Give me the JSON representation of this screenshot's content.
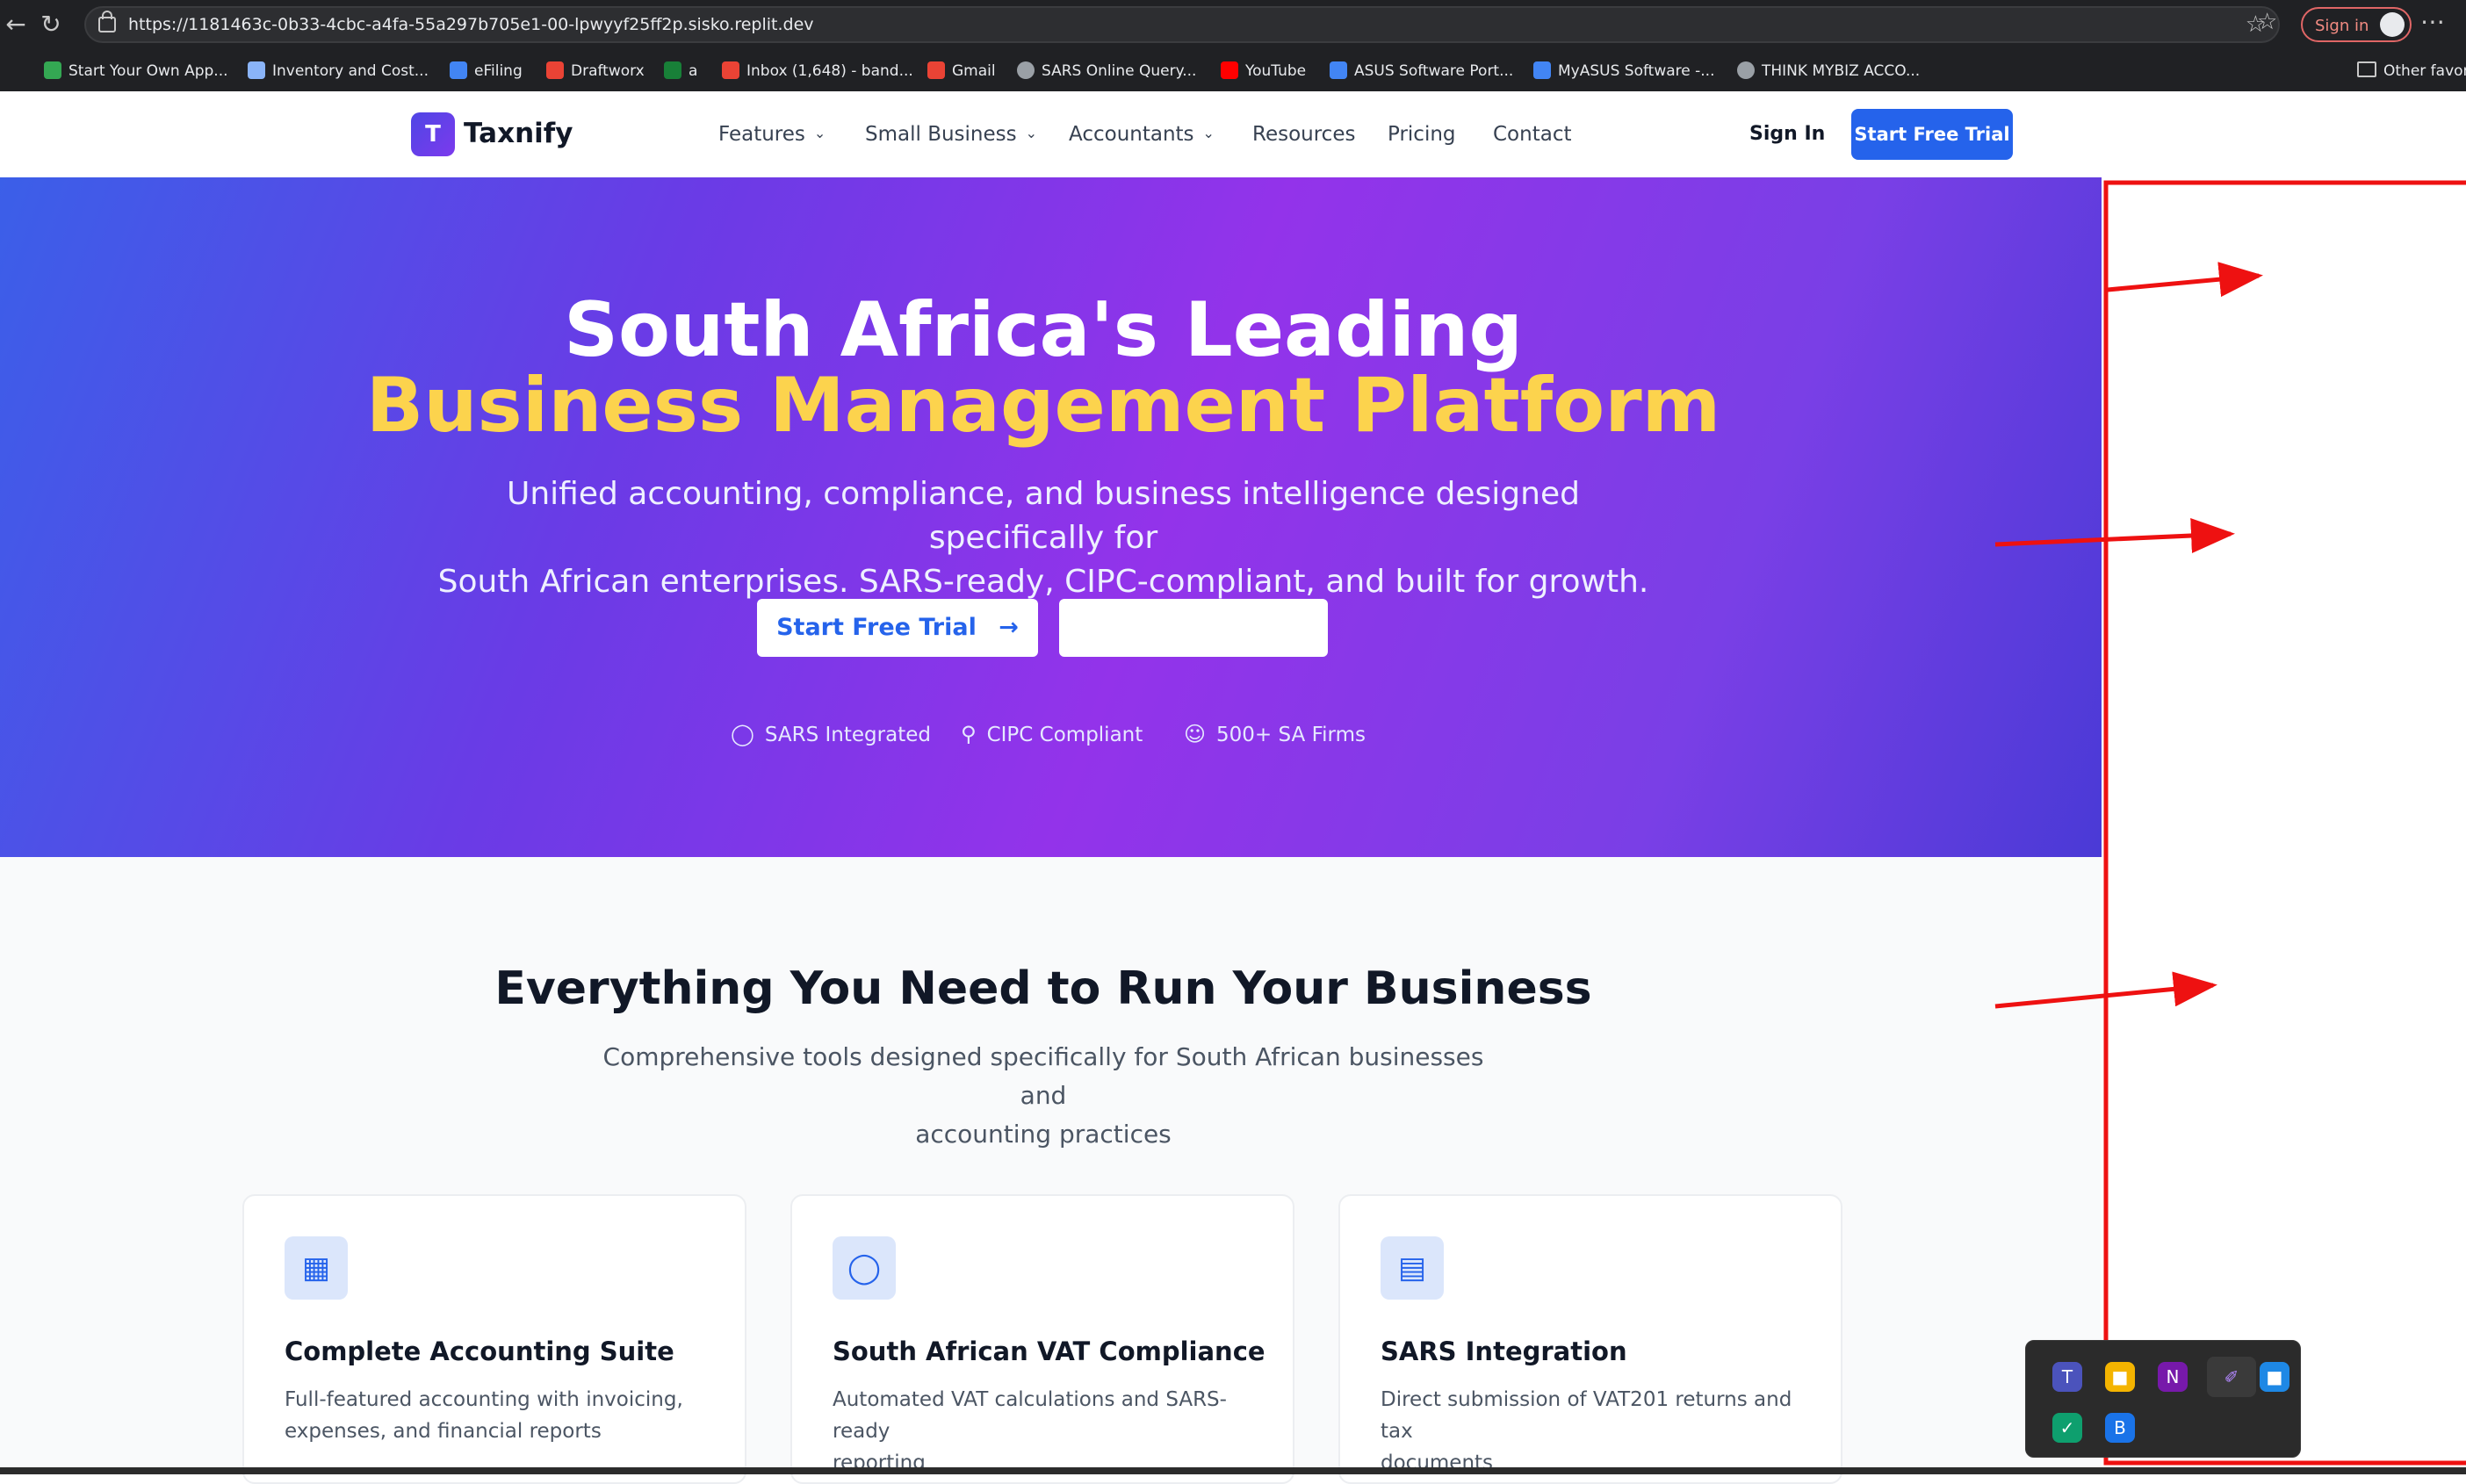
{
  "browser": {
    "url": "https://1181463c-0b33-4cbc-a4fa-55a297b705e1-00-lpwyyf25ff2p.sisko.replit.dev",
    "signin_label": "Sign in",
    "bookmarks": [
      {
        "label": "Start Your Own App...",
        "color": "#34a853"
      },
      {
        "label": "Inventory and Cost...",
        "color": "#8ab4f8"
      },
      {
        "label": "eFiling",
        "color": "#4285f4"
      },
      {
        "label": "Draftworx",
        "color": "#ea4335"
      },
      {
        "label": "a",
        "color": "#188038"
      },
      {
        "label": "Inbox (1,648) - band...",
        "color": "#ea4335"
      },
      {
        "label": "Gmail",
        "color": "#ea4335"
      },
      {
        "label": "SARS Online Query...",
        "color": "#9aa0a6"
      },
      {
        "label": "YouTube",
        "color": "#ff0000"
      },
      {
        "label": "ASUS Software Port...",
        "color": "#4285f4"
      },
      {
        "label": "MyASUS Software -...",
        "color": "#4285f4"
      },
      {
        "label": "THINK MYBIZ ACCO...",
        "color": "#9aa0a6"
      },
      {
        "label": "Other favor",
        "color": "#9aa0a6"
      }
    ]
  },
  "nav": {
    "logo_letter": "T",
    "brand": "Taxnify",
    "links": [
      "Features",
      "Small Business",
      "Accountants",
      "Resources",
      "Pricing",
      "Contact"
    ],
    "signin": "Sign In",
    "trial": "Start Free Trial"
  },
  "hero": {
    "title_line1": "South Africa's Leading",
    "title_line2": "Business Management Platform",
    "subtitle_line1": "Unified accounting, compliance, and business intelligence designed specifically for",
    "subtitle_line2": "South African enterprises. SARS-ready, CIPC-compliant, and built for growth.",
    "primary_cta": "Start Free Trial",
    "secondary_cta": "",
    "trust": [
      "SARS Integrated",
      "CIPC Compliant",
      "500+ SA Firms"
    ]
  },
  "features": {
    "title": "Everything You Need to Run Your Business",
    "subtitle_line1": "Comprehensive tools designed specifically for South African businesses and",
    "subtitle_line2": "accounting practices",
    "cards": [
      {
        "icon": "calculator-icon",
        "title": "Complete Accounting Suite",
        "desc_line1": "Full-featured accounting with invoicing,",
        "desc_line2": "expenses, and financial reports"
      },
      {
        "icon": "shield-icon",
        "title": "South African VAT Compliance",
        "desc_line1": "Automated VAT calculations and SARS-ready",
        "desc_line2": "reporting"
      },
      {
        "icon": "document-icon",
        "title": "SARS Integration",
        "desc_line1": "Direct submission of VAT201 returns and tax",
        "desc_line2": "documents"
      }
    ]
  },
  "colors": {
    "brand_blue": "#2563eb",
    "hero_purple": "#9333ea",
    "highlight_yellow": "#fcd34d",
    "annotation_red": "#ee1111"
  }
}
